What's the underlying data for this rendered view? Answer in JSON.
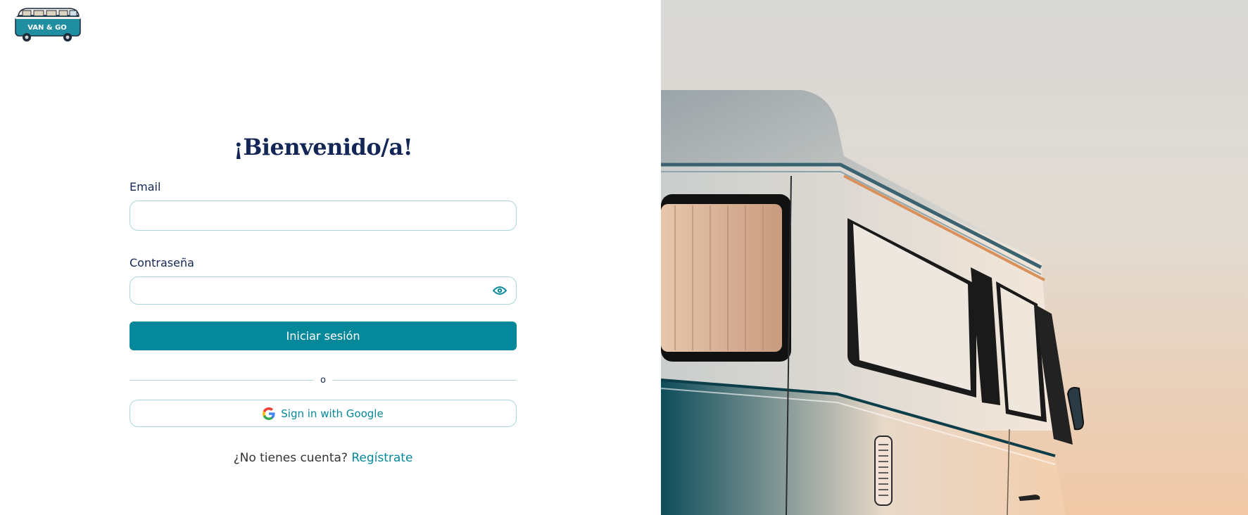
{
  "logo": {
    "text": "VAN & GO"
  },
  "login": {
    "title": "¡Bienvenido/a!",
    "email_label": "Email",
    "email_value": "",
    "password_label": "Contraseña",
    "password_value": "",
    "submit_label": "Iniciar sesión",
    "divider_text": "o",
    "google_label": "Sign in with Google",
    "signup_prompt": "¿No tienes cuenta?",
    "signup_link": "Regístrate"
  },
  "icons": {
    "eye": "eye-icon",
    "google": "google-icon"
  },
  "colors": {
    "accent": "#05889a",
    "title": "#142656",
    "border": "#a9d6d8"
  }
}
